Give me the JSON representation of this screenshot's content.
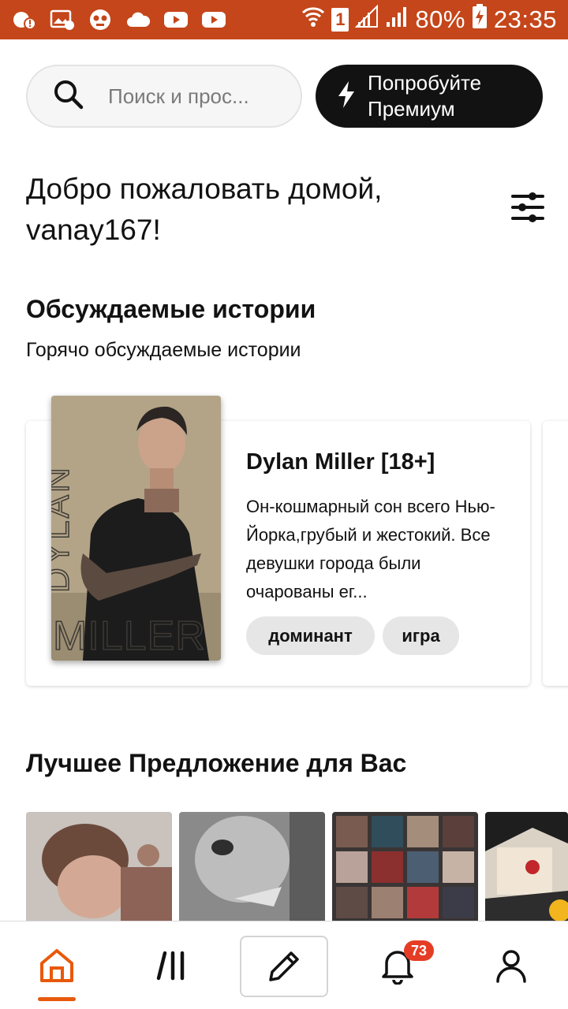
{
  "status_bar": {
    "battery": "80%",
    "time": "23:35",
    "sim": "1"
  },
  "search": {
    "placeholder": "Поиск и прос..."
  },
  "premium": {
    "label_line1": "Попробуйте",
    "label_line2": "Премиум"
  },
  "welcome": {
    "line1": "Добро пожаловать домой,",
    "line2": "vanay167!"
  },
  "discussed": {
    "title": "Обсуждаемые истории",
    "subtitle": "Горячо обсуждаемые истории",
    "story": {
      "title": "Dylan Miller [18+]",
      "description": "Он-кошмарный сон всего Нью-Йорка,грубый и жестокий. Все девушки города были очарованы ег...",
      "cover_text_vertical": "DYLAN",
      "cover_text_bottom": "MILLER",
      "tags": [
        "доминант",
        "игра"
      ]
    }
  },
  "best_offer": {
    "title": "Лучшее Предложение для Вас"
  },
  "nav": {
    "notifications_count": "73"
  },
  "colors": {
    "accent": "#e8590c",
    "status_bar": "#c4461a",
    "badge": "#e53c25",
    "dark": "#121212"
  }
}
